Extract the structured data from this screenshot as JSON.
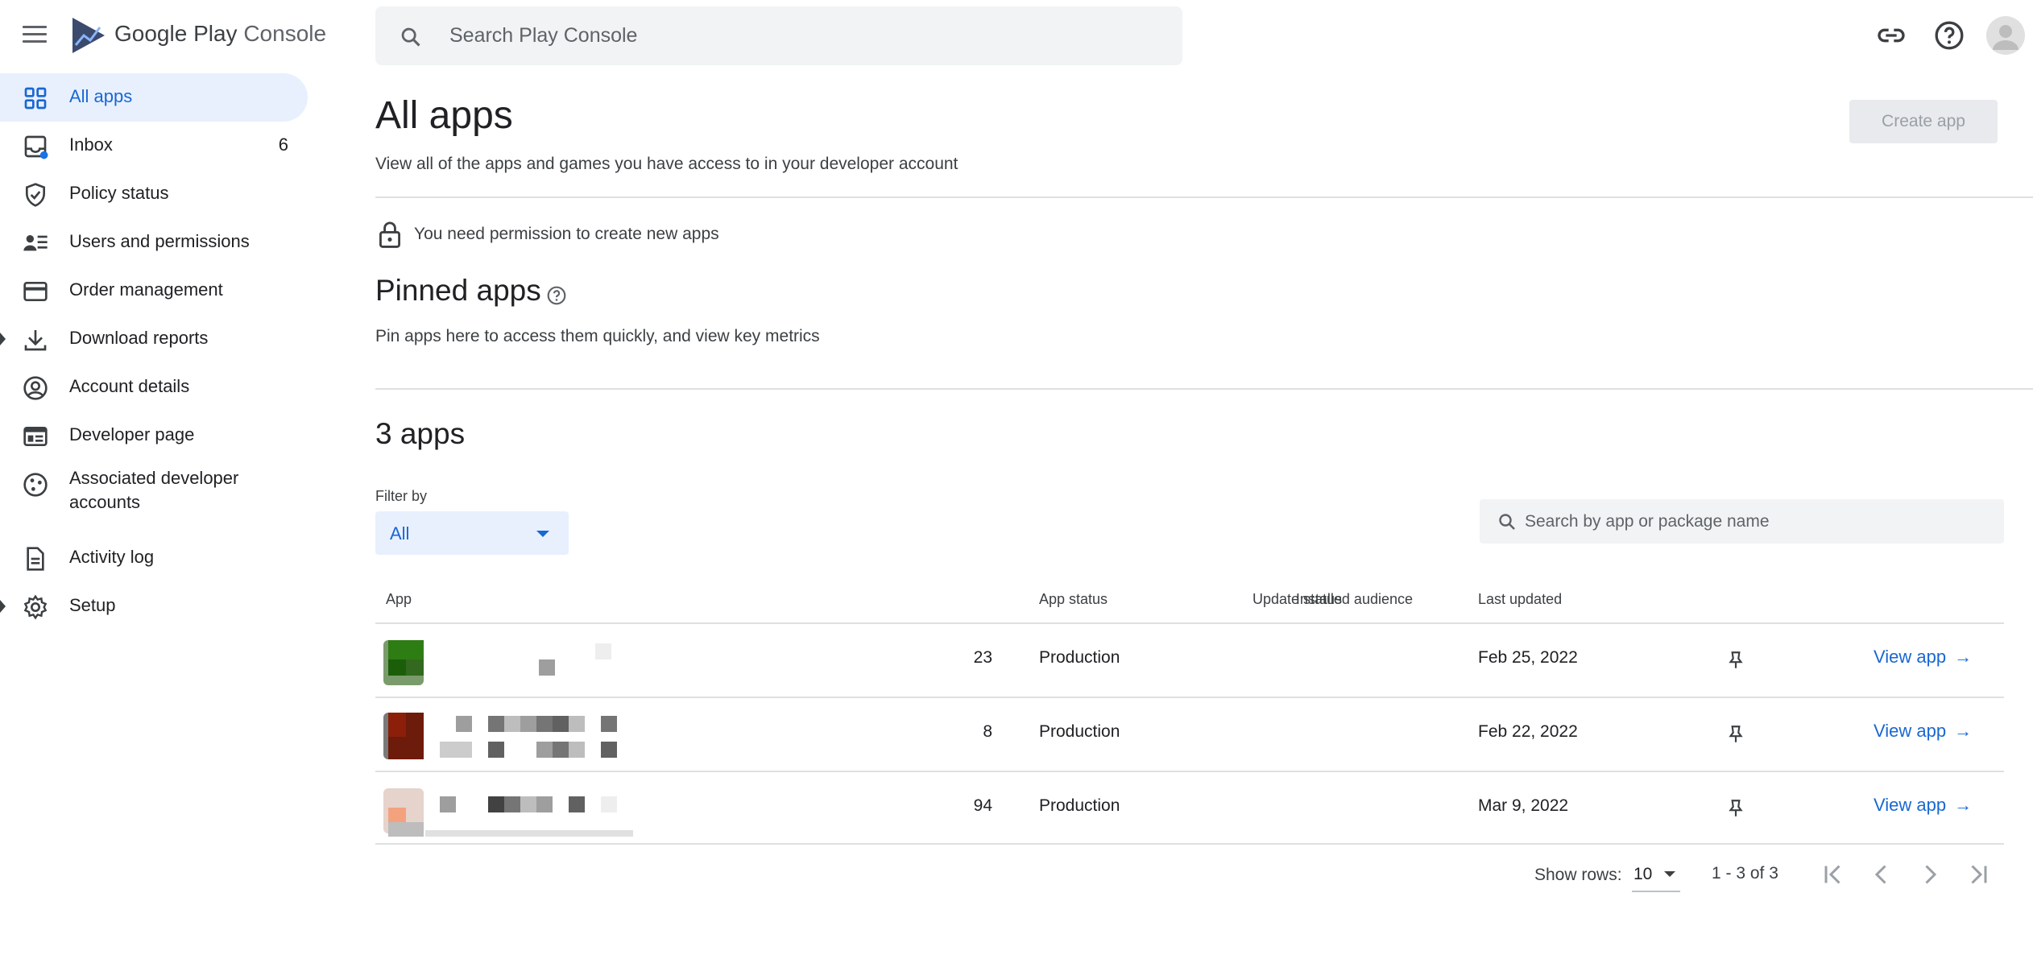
{
  "header": {
    "brand_google": "Google Play",
    "brand_console": "Console",
    "search_placeholder": "Search Play Console"
  },
  "sidebar": {
    "items": [
      {
        "label": "All apps",
        "icon": "grid-icon",
        "active": true
      },
      {
        "label": "Inbox",
        "icon": "inbox-icon",
        "count": "6"
      },
      {
        "label": "Policy status",
        "icon": "shield-icon"
      },
      {
        "label": "Users and permissions",
        "icon": "users-icon"
      },
      {
        "label": "Order management",
        "icon": "credit-card-icon"
      },
      {
        "label": "Download reports",
        "icon": "download-icon"
      },
      {
        "label": "Account details",
        "icon": "account-circle-icon"
      },
      {
        "label": "Developer page",
        "icon": "web-page-icon"
      },
      {
        "label": "Associated developer accounts",
        "icon": "linked-accounts-icon"
      },
      {
        "label": "Activity log",
        "icon": "document-icon"
      },
      {
        "label": "Setup",
        "icon": "gear-icon"
      }
    ]
  },
  "main": {
    "title": "All apps",
    "subtitle": "View all of the apps and games you have access to in your developer account",
    "create_button": "Create app",
    "permission_notice": "You need permission to create new apps",
    "pinned": {
      "title": "Pinned apps",
      "subtitle": "Pin apps here to access them quickly, and view key metrics"
    },
    "apps_count_title": "3 apps",
    "filter": {
      "label": "Filter by",
      "value": "All"
    },
    "app_search_placeholder": "Search by app or package name",
    "table": {
      "headers": [
        "App",
        "Installed audience",
        "App status",
        "Update status",
        "Last updated"
      ],
      "rows": [
        {
          "installed": "23",
          "status": "Production",
          "update_status": "",
          "last_updated": "Feb 25, 2022",
          "action": "View app",
          "accent": "#2e7d14"
        },
        {
          "installed": "8",
          "status": "Production",
          "update_status": "",
          "last_updated": "Feb 22, 2022",
          "action": "View app",
          "accent": "#8b1f0a"
        },
        {
          "installed": "94",
          "status": "Production",
          "update_status": "",
          "last_updated": "Mar 9, 2022",
          "action": "View app",
          "accent": "#f4a27e"
        }
      ]
    },
    "pagination": {
      "show_rows_label": "Show rows:",
      "rows_value": "10",
      "range": "1 - 3 of 3"
    }
  },
  "colors": {
    "accent": "#1967d2",
    "active_bg": "#e8f0fe"
  }
}
